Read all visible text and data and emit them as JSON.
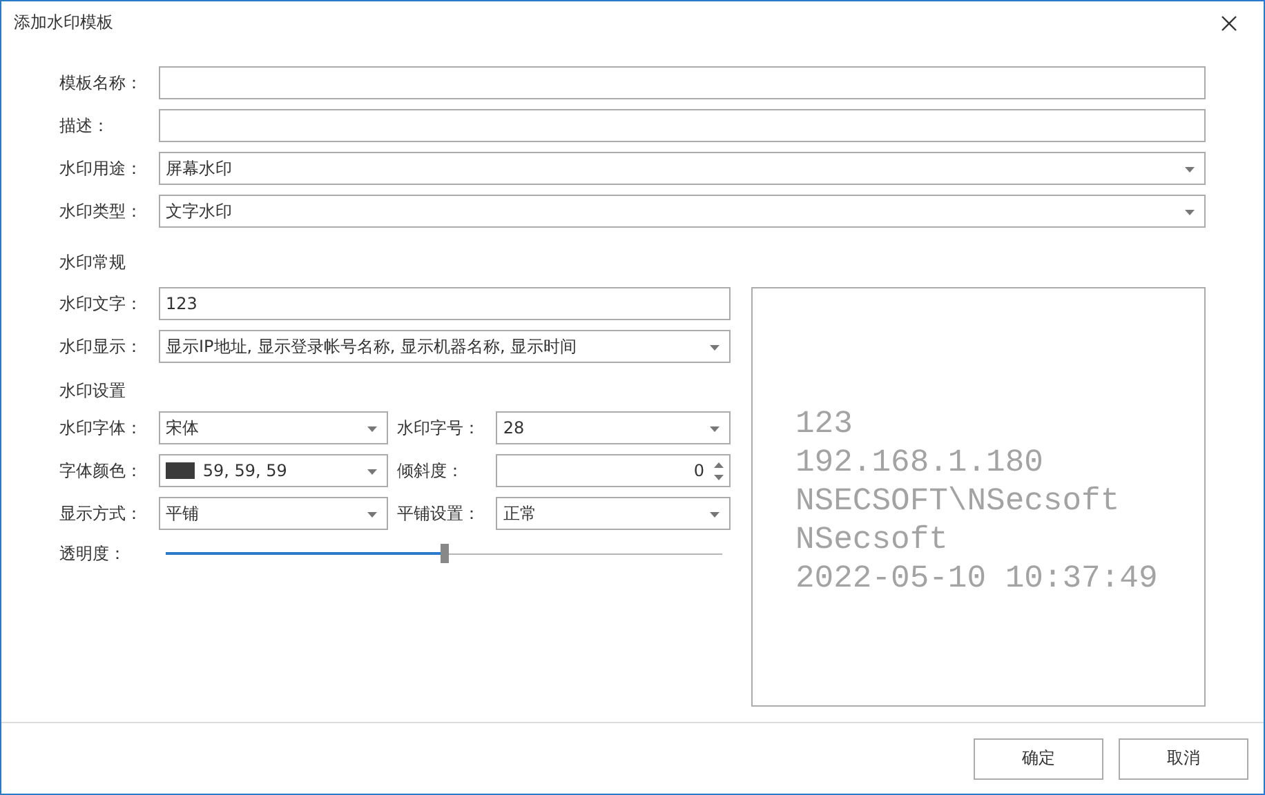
{
  "window": {
    "title": "添加水印模板"
  },
  "fields": [
    {
      "label": "模板名称：",
      "kind": "text"
    },
    {
      "label": "描述：",
      "kind": "text"
    },
    {
      "label": "水印用途：",
      "kind": "combo",
      "value": "屏幕水印"
    },
    {
      "label": "水印类型：",
      "kind": "combo",
      "value": "文字水印"
    }
  ],
  "general": {
    "heading": "水印常规",
    "fields": [
      {
        "label": "水印文字：",
        "kind": "text",
        "value": "123"
      },
      {
        "label": "水印显示：",
        "kind": "combo",
        "value": "显示IP地址, 显示登录帐号名称, 显示机器名称, 显示时间"
      }
    ]
  },
  "settings": {
    "heading": "水印设置",
    "rows": [
      [
        {
          "label": "水印字体：",
          "kind": "combo",
          "value": "宋体"
        },
        {
          "label": "水印字号：",
          "kind": "combo",
          "value": "28"
        }
      ],
      [
        {
          "label": "字体颜色：",
          "kind": "color",
          "value": "59, 59, 59"
        },
        {
          "label": "倾斜度：",
          "kind": "spin",
          "value": "0"
        }
      ],
      [
        {
          "label": "显示方式：",
          "kind": "combo",
          "value": "平铺"
        },
        {
          "label": "平铺设置：",
          "kind": "combo",
          "value": "正常"
        }
      ]
    ],
    "opacity": {
      "label": "透明度：",
      "level": 0.5
    }
  },
  "preview": {
    "lines": [
      "123",
      "192.168.1.180",
      "NSECSOFT\\NSecsoft",
      "NSecsoft",
      "2022-05-10 10:37:49"
    ]
  },
  "buttons": [
    {
      "label": "确定"
    },
    {
      "label": "取消"
    }
  ]
}
